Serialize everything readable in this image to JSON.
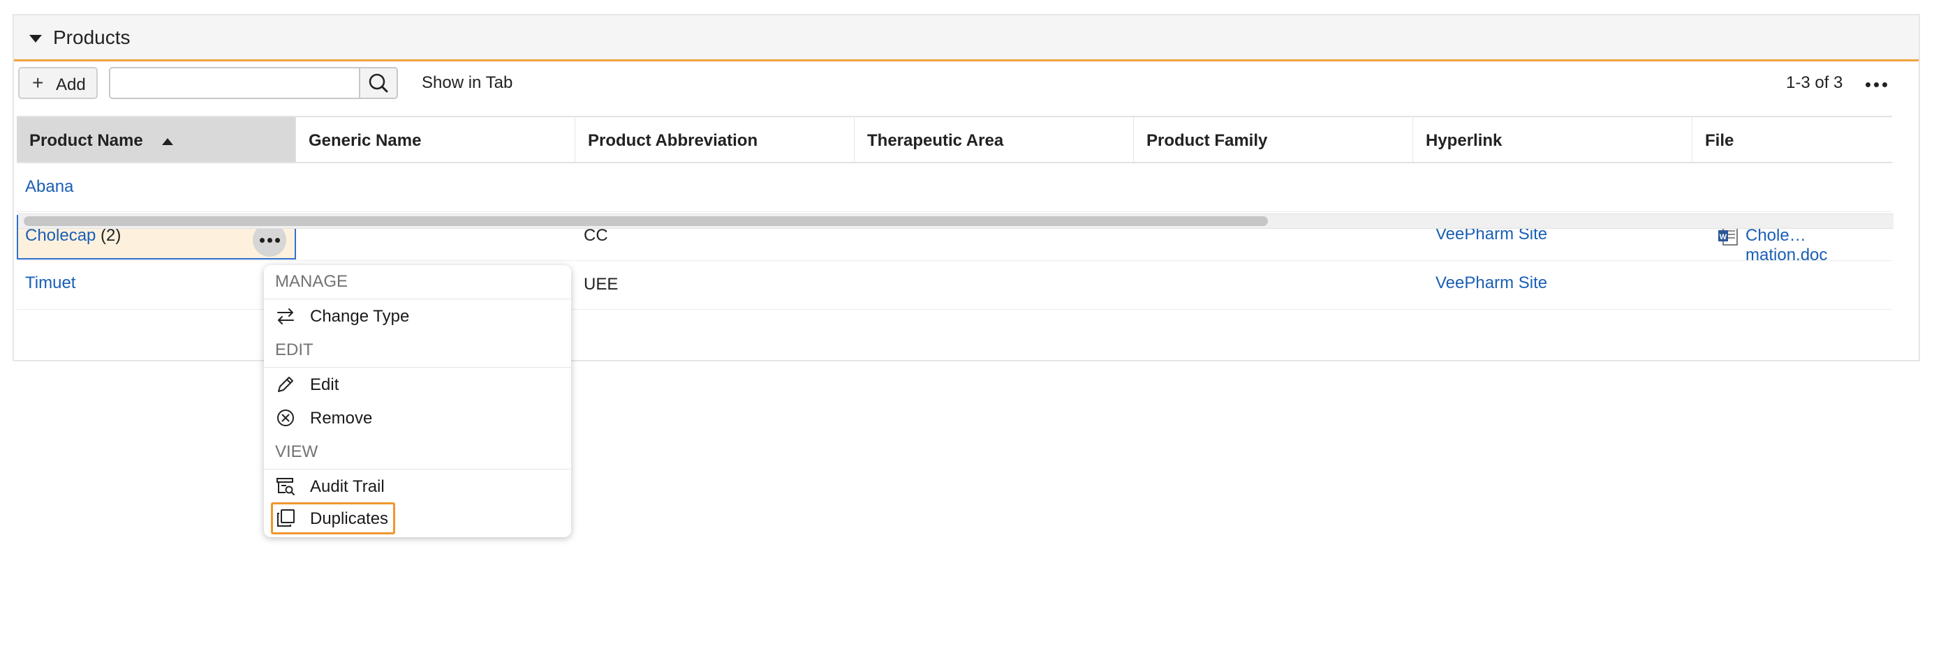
{
  "panel": {
    "title": "Products"
  },
  "toolbar": {
    "add_label": "Add",
    "search_value": "",
    "show_in_tab": "Show in Tab",
    "count": "1-3 of 3"
  },
  "table": {
    "columns": [
      "Product Name",
      "Generic Name",
      "Product Abbreviation",
      "Therapeutic Area",
      "Product Family",
      "Hyperlink",
      "File"
    ],
    "sorted_column": "Product Name",
    "sort_direction": "ascending",
    "rows": [
      {
        "product_name": "Abana",
        "generic_name": "",
        "abbreviation": "",
        "therapeutic_area": "",
        "product_family": "",
        "hyperlink": "",
        "file": ""
      },
      {
        "product_name": "Cholecap",
        "count": "(2)",
        "generic_name": "",
        "abbreviation": "CC",
        "therapeutic_area": "",
        "product_family": "",
        "hyperlink": "VeePharm Site",
        "file": "Chole… mation.doc"
      },
      {
        "product_name": "Timuet",
        "generic_name": "",
        "abbreviation": "UEE",
        "therapeutic_area": "",
        "product_family": "",
        "hyperlink": "VeePharm Site",
        "file": ""
      }
    ]
  },
  "menu": {
    "sections": [
      {
        "label": "MANAGE",
        "items": [
          {
            "label": "Change Type",
            "icon": "swap-arrows-icon"
          }
        ]
      },
      {
        "label": "EDIT",
        "items": [
          {
            "label": "Edit",
            "icon": "pencil-icon"
          },
          {
            "label": "Remove",
            "icon": "remove-circle-icon"
          }
        ]
      },
      {
        "label": "VIEW",
        "items": [
          {
            "label": "Audit Trail",
            "icon": "audit-trail-icon"
          },
          {
            "label": "Duplicates",
            "icon": "duplicates-icon"
          }
        ]
      }
    ]
  },
  "colors": {
    "accent": "#f0a33c",
    "link": "#1a5fb4",
    "focus": "#f0962e",
    "selection_bg": "#fdf1de",
    "selection_border": "#2f6fd0"
  }
}
